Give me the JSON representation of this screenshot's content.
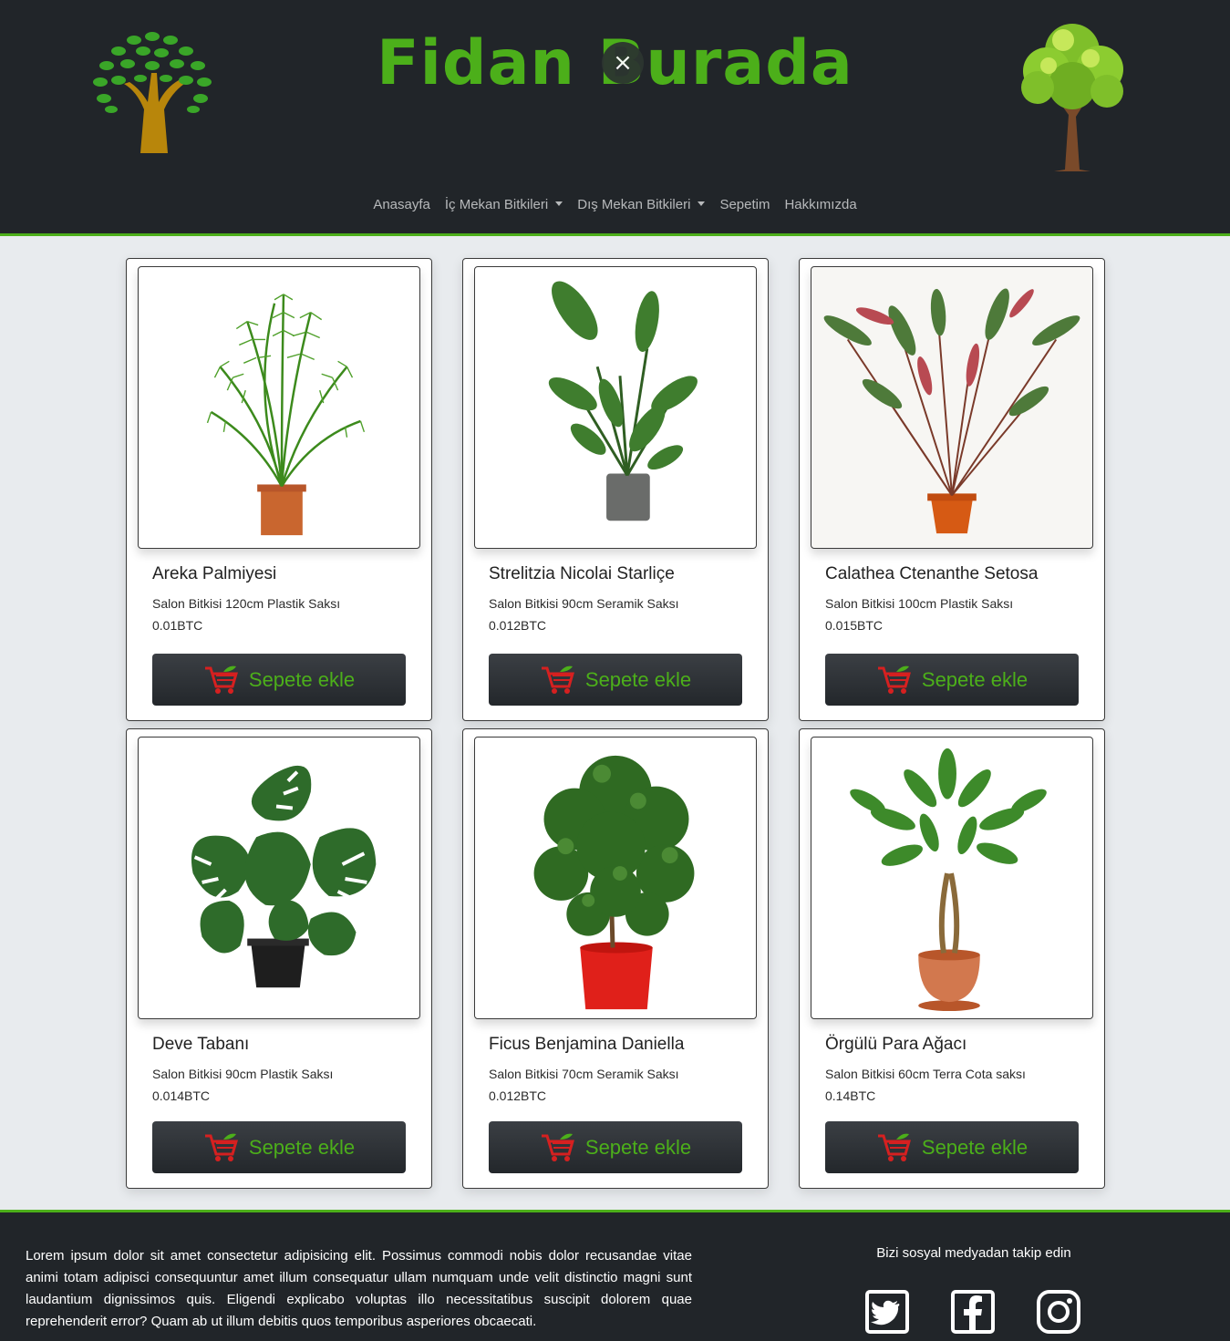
{
  "header": {
    "brand": "Fidan Burada",
    "close_symbol": "×",
    "logo_left": "tree-logo-icon",
    "logo_right": "tree-icon"
  },
  "nav": {
    "items": [
      {
        "label": "Anasayfa",
        "dropdown": false
      },
      {
        "label": "İç Mekan Bitkileri",
        "dropdown": true
      },
      {
        "label": "Dış Mekan Bitkileri",
        "dropdown": true
      },
      {
        "label": "Sepetim",
        "dropdown": false
      },
      {
        "label": "Hakkımızda",
        "dropdown": false
      }
    ]
  },
  "products": [
    {
      "name": "Areka Palmiyesi",
      "desc": "Salon Bitkisi 120cm Plastik Saksı",
      "price": "0.01BTC",
      "image": "areca-palm-image"
    },
    {
      "name": "Strelitzia Nicolai Starliçe",
      "desc": "Salon Bitkisi 90cm Seramik Saksı",
      "price": "0.012BTC",
      "image": "strelitzia-image"
    },
    {
      "name": "Calathea Ctenanthe Setosa",
      "desc": "Salon Bitkisi 100cm Plastik Saksı",
      "price": "0.015BTC",
      "image": "calathea-image"
    },
    {
      "name": "Deve Tabanı",
      "desc": "Salon Bitkisi 90cm Plastik Saksı",
      "price": "0.014BTC",
      "image": "monstera-image"
    },
    {
      "name": "Ficus Benjamina Daniella",
      "desc": "Salon Bitkisi 70cm Seramik Saksı",
      "price": "0.012BTC",
      "image": "ficus-image"
    },
    {
      "name": "Örgülü Para Ağacı",
      "desc": "Salon Bitkisi 60cm Terra Cota saksı",
      "price": "0.14BTC",
      "image": "money-tree-image"
    }
  ],
  "cart_button_label": "Sepete ekle",
  "footer": {
    "text": "Lorem ipsum dolor sit amet consectetur adipisicing elit. Possimus commodi nobis dolor recusandae vitae animi totam adipisci consequuntur amet illum consequatur ullam numquam unde velit distinctio magni sunt laudantium dignissimos quis. Eligendi explicabo voluptas illo necessitatibus suscipit dolorem quae reprehenderit error? Quam ab ut illum debitis quos temporibus asperiores obcaecati.",
    "social_title": "Bizi sosyal medyadan takip edin",
    "social": [
      "twitter-icon",
      "facebook-icon",
      "instagram-icon"
    ]
  },
  "colors": {
    "accent": "#4caf1a",
    "dark": "#212529",
    "background": "#e8ebee",
    "cart_red": "#d62020"
  }
}
